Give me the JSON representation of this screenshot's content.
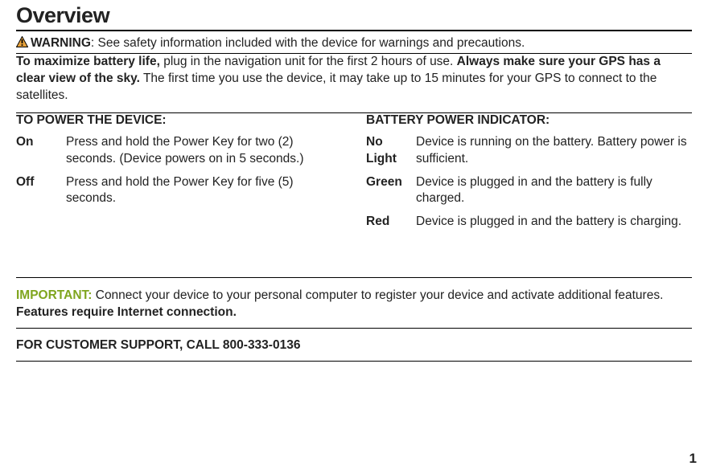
{
  "title": "Overview",
  "warning": {
    "label": "WARNING",
    "text": ": See safety information included with the device for warnings and precautions."
  },
  "battery_para": {
    "lead": "To maximize battery life,",
    "mid": " plug in the navigation unit for the first 2 hours of use. ",
    "bold2": "Always make sure your GPS has a clear view of the sky.",
    "tail": " The first time you use the device, it may take up to 15 minutes for your GPS to connect to the satellites."
  },
  "power": {
    "heading": "TO POWER THE DEVICE:",
    "on_term": "On",
    "on_desc": "Press and hold the Power Key for two (2) seconds. (Device powers on in 5 seconds.)",
    "off_term": "Off",
    "off_desc": "Press and hold the Power Key for five (5) seconds."
  },
  "indicator": {
    "heading": "BATTERY POWER INDICATOR:",
    "nolight_term": "No Light",
    "nolight_desc": "Device is running on the battery. Battery power is sufficient.",
    "green_term": "Green",
    "green_desc": "Device is plugged in and the battery is fully charged.",
    "red_term": "Red",
    "red_desc": "Device is plugged in and the battery is charging."
  },
  "important": {
    "label": "IMPORTANT:",
    "text": " Connect your device to your personal computer to register your device and activate additional features. ",
    "bold_tail": "Features require Internet connection."
  },
  "support": "FOR CUSTOMER SUPPORT, CALL 800-333-0136",
  "page_number": "1"
}
